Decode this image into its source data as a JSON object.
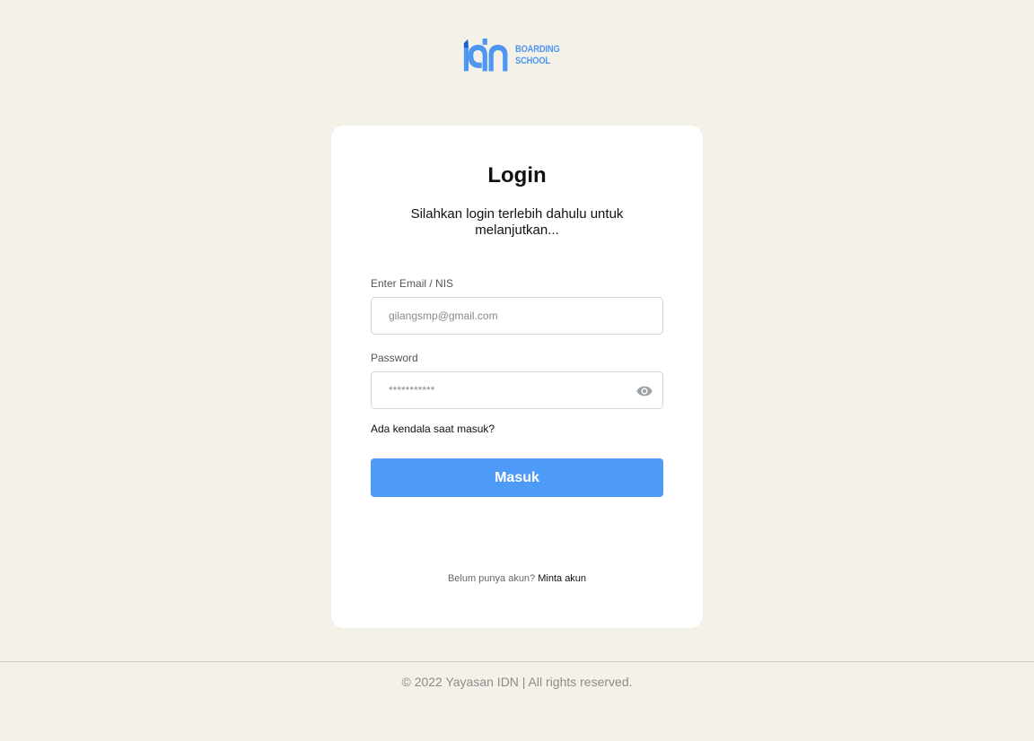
{
  "brand": {
    "logo_text_line1": "BOARDING",
    "logo_text_line2": "SCHOOL",
    "color": "#4e96f1"
  },
  "login": {
    "title": "Login",
    "subtitle": "Silahkan login terlebih dahulu untuk melanjutkan...",
    "email_label": "Enter Email / NIS",
    "email_placeholder": "gilangsmp@gmail.com",
    "password_label": "Password",
    "password_placeholder": "***********",
    "password_toggle_icon": "eye-icon",
    "trouble_link": "Ada kendala saat masuk?",
    "submit_label": "Masuk",
    "submit_color": "#4d9af7",
    "signup_prompt": "Belum punya akun?",
    "signup_link": "Minta akun"
  },
  "footer": {
    "text": "© 2022 Yayasan IDN | All rights reserved."
  }
}
